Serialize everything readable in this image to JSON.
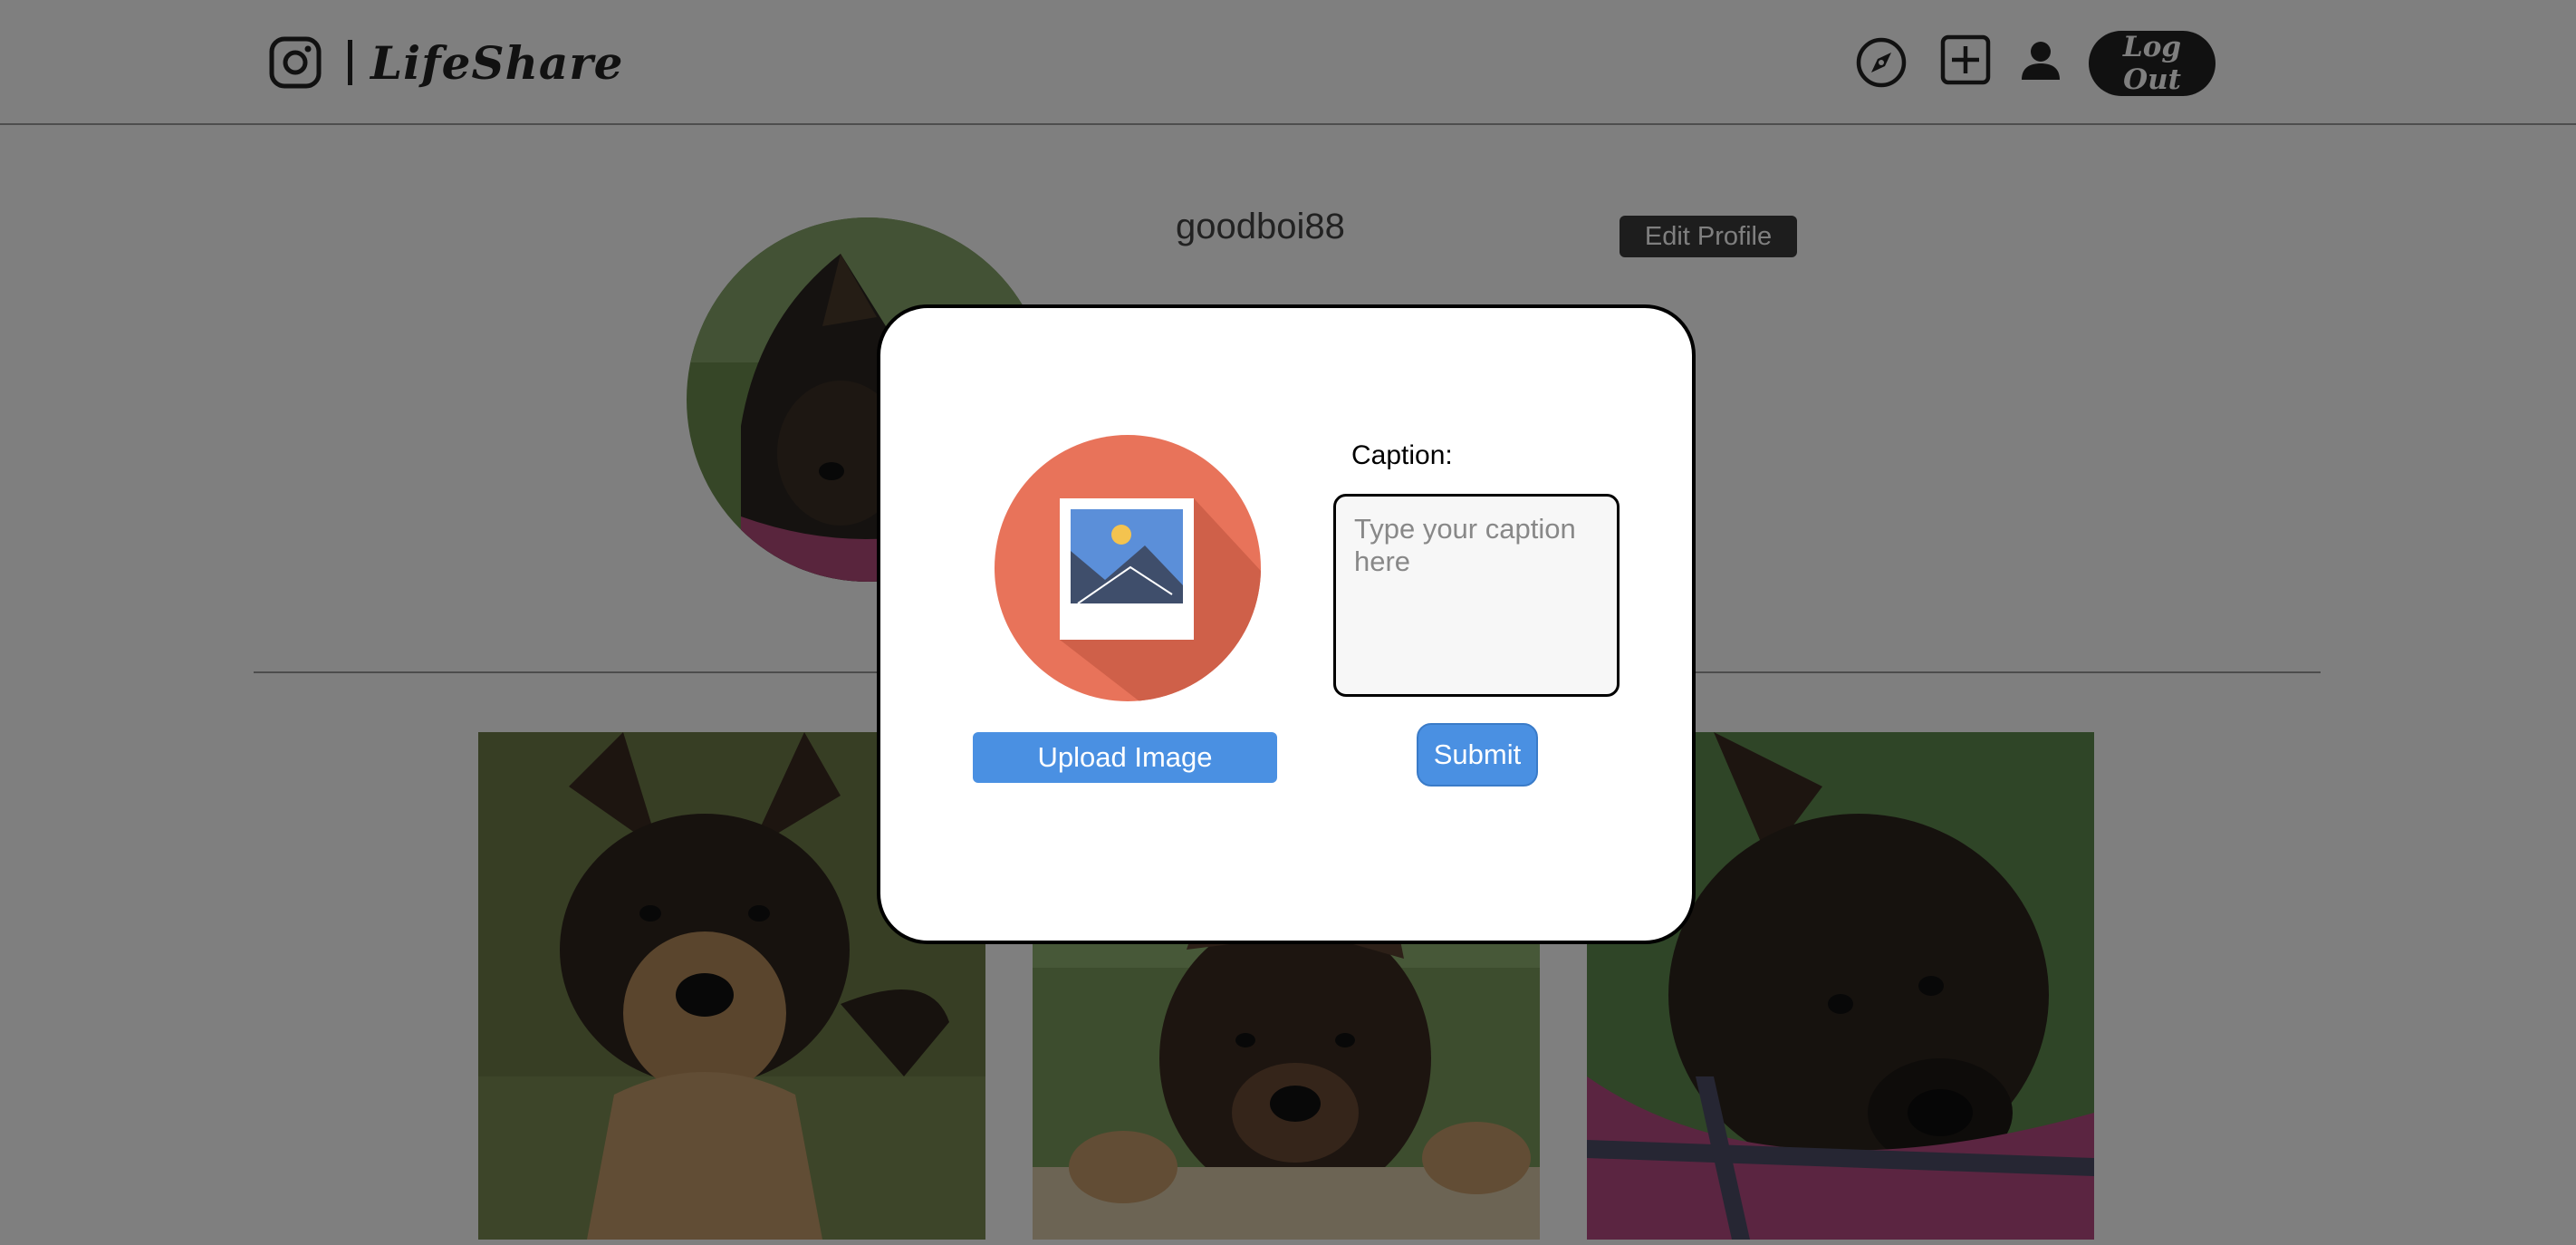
{
  "navbar": {
    "brand_name": "LifeShare",
    "logo_icon": "instagram-logo-icon",
    "explore_icon": "compass-icon",
    "new_post_icon": "plus-square-icon",
    "profile_icon": "person-icon",
    "logout_label": "Log Out"
  },
  "profile": {
    "username": "goodboi88",
    "edit_label": "Edit Profile"
  },
  "posts": [
    {
      "icon": "puppy-photo"
    },
    {
      "icon": "puppy-photo"
    },
    {
      "icon": "puppy-photo"
    }
  ],
  "modal": {
    "illustration_icon": "image-placeholder-icon",
    "upload_label": "Upload Image",
    "caption_label": "Caption:",
    "caption_placeholder": "Type your caption here",
    "caption_value": "",
    "submit_label": "Submit"
  },
  "colors": {
    "accent": "#4a90e2",
    "dark": "#222222",
    "overlay": "rgba(0,0,0,0.5)",
    "illustration_circle": "#e8735a"
  }
}
